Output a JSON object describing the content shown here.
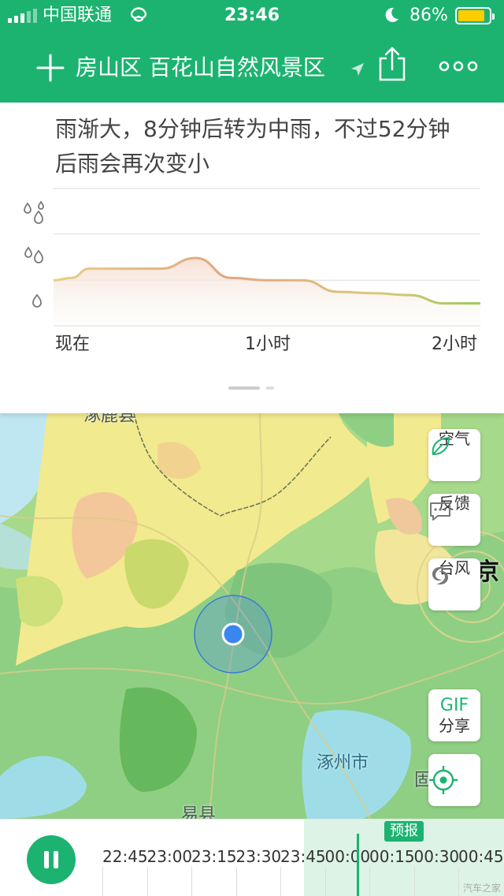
{
  "status": {
    "carrier": "中国联通",
    "time": "23:46",
    "battery_pct": "86%",
    "battery_level": 0.86,
    "battery_color": "#ffcc00"
  },
  "header": {
    "location": "房山区 百花山自然风景区",
    "add_icon": "plus-icon",
    "location_icon": "location-arrow-icon",
    "share_icon": "share-icon",
    "more_icon": "more-icon",
    "bg_color": "#1cb371"
  },
  "forecast": {
    "headline": "雨渐大，8分钟后转为中雨，不过52分钟后雨会再次变小",
    "ticks": [
      "现在",
      "1小时",
      "2小时"
    ]
  },
  "chart_data": {
    "type": "area",
    "x_range": [
      0,
      120
    ],
    "y_levels": [
      "小雨",
      "中雨",
      "大雨"
    ],
    "y_range": [
      0,
      3
    ],
    "grid": true,
    "x": [
      0,
      5,
      10,
      20,
      30,
      40,
      50,
      60,
      65,
      70,
      80,
      90,
      100,
      110,
      120
    ],
    "values": [
      1.0,
      1.05,
      1.25,
      1.25,
      1.25,
      1.48,
      1.05,
      1.0,
      1.0,
      1.0,
      0.75,
      0.72,
      0.68,
      0.5,
      0.5
    ]
  },
  "map": {
    "labels": [
      "涿鹿县",
      "涿州市",
      "易县",
      "京",
      "固"
    ],
    "buttons": {
      "air": "空气",
      "feedback": "反馈",
      "typhoon": "台风",
      "gif": "GIF",
      "share": "分享"
    }
  },
  "timeline": {
    "forecast_flag": "预报",
    "times": [
      "22:45",
      "23:00",
      "23:15",
      "23:30",
      "23:45",
      "00:00",
      "00:15",
      "00:30",
      "00:45"
    ],
    "accent": "#1cb371"
  },
  "watermark": "汽车之家"
}
